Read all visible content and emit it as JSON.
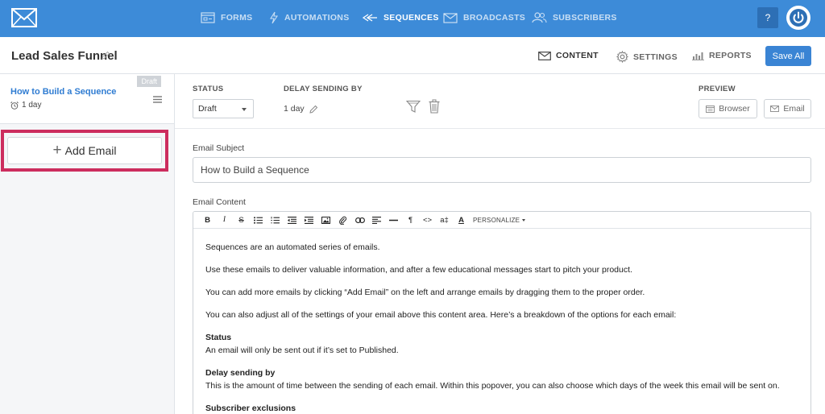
{
  "nav": {
    "items": [
      {
        "label": "FORMS",
        "icon": "forms-icon"
      },
      {
        "label": "AUTOMATIONS",
        "icon": "lightning-icon"
      },
      {
        "label": "SEQUENCES",
        "icon": "sequences-icon"
      },
      {
        "label": "BROADCASTS",
        "icon": "envelope-icon"
      },
      {
        "label": "SUBSCRIBERS",
        "icon": "users-icon"
      }
    ],
    "active": "SEQUENCES",
    "help_label": "?"
  },
  "header": {
    "title": "Lead Sales Funnel",
    "tabs": [
      {
        "label": "CONTENT",
        "icon": "envelope-icon"
      },
      {
        "label": "SETTINGS",
        "icon": "gear-icon"
      },
      {
        "label": "REPORTS",
        "icon": "bar-chart-icon"
      }
    ],
    "save_label": "Save All"
  },
  "sidebar": {
    "email": {
      "badge": "Draft",
      "title": "How to Build a Sequence",
      "delay": "1 day"
    },
    "add_email_label": "Add Email"
  },
  "settings": {
    "status_label": "STATUS",
    "status_value": "Draft",
    "delay_label": "DELAY SENDING BY",
    "delay_value": "1 day",
    "preview_label": "PREVIEW",
    "preview_browser": "Browser",
    "preview_email": "Email"
  },
  "email": {
    "subject_label": "Email Subject",
    "subject_value": "How to Build a Sequence",
    "content_label": "Email Content",
    "toolbar": {
      "bold": "B",
      "italic": "I",
      "strike": "S",
      "paragraph": "¶",
      "code": "<>",
      "case": "a‡",
      "underline": "A",
      "personalize": "PERSONALIZE"
    },
    "paragraphs": [
      "Sequences are an automated series of emails.",
      "Use these emails to deliver valuable information, and after a few educational messages start to pitch your product.",
      "You can add more emails by clicking “Add Email” on the left and arrange emails by dragging them to the proper order.",
      "You can also adjust all of the settings of your email above this content area. Here’s a breakdown of the options for each email:"
    ],
    "sections": [
      {
        "heading": "Status",
        "text": "An email will only be sent out if it’s set to Published."
      },
      {
        "heading": "Delay sending by",
        "text": "This is the amount of time between the sending of each email. Within this popover, you can also choose which days of the week this email will be sent on."
      },
      {
        "heading": "Subscriber exclusions",
        "text": ""
      }
    ]
  },
  "colors": {
    "brand": "#3d8bd8",
    "link": "#2f7cd2",
    "highlight": "#cc2d5e"
  }
}
